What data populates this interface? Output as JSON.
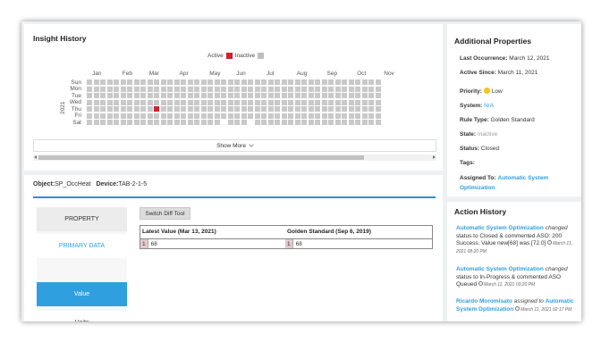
{
  "insight": {
    "title": "Insight History",
    "legend": {
      "active": "Active",
      "inactive": "Inactive"
    },
    "year": "2021",
    "months": [
      "Jan",
      "Feb",
      "Mar",
      "Apr",
      "May",
      "Jun",
      "Jul",
      "Aug",
      "Sep",
      "Oct",
      "Nov"
    ],
    "days": [
      "Sun",
      "Mon",
      "Tue",
      "Wed",
      "Thu",
      "Fri",
      "Sat"
    ],
    "show_more": "Show More"
  },
  "object": {
    "object_label": "Object:",
    "object_value": "SP_OccHeat",
    "device_label": "Device:",
    "device_value": "TAB-2-1-5"
  },
  "property_tabs": {
    "header": "PROPERTY",
    "primary": "PRIMARY DATA",
    "value": "Value",
    "units": "Units"
  },
  "diff": {
    "switch_button": "Switch Diff Tool",
    "left_header": "Latest Value (Mar 13, 2021)",
    "right_header": "Golden Standard (Sep 6, 2019)",
    "left_line_no": "1",
    "left_value": "68",
    "right_line_no": "1",
    "right_value": "68"
  },
  "additional": {
    "title": "Additional Properties",
    "last_occurrence_label": "Last Occurrence:",
    "last_occurrence_value": "March 12, 2021",
    "active_since_label": "Active Since:",
    "active_since_value": "March 11, 2021",
    "priority_label": "Priority:",
    "priority_value": "Low",
    "system_label": "System:",
    "system_value": "N/A",
    "rule_type_label": "Rule Type:",
    "rule_type_value": "Golden Standard",
    "state_label": "State:",
    "state_value": "Inactive",
    "status_label": "Status:",
    "status_value": "Closed",
    "tags_label": "Tags:",
    "assigned_label": "Assigned To:",
    "assigned_value_1": "Automatic System",
    "assigned_value_2": "Optimization"
  },
  "action_history": {
    "title": "Action History",
    "entries": [
      {
        "actor": "Automatic System Optimization",
        "verb": "changed",
        "text": "status to Closed & commented ASO: 200 Success. Value new[68] was [72.0]",
        "time": "March 11, 2021 08:20 PM"
      },
      {
        "actor": "Automatic System Optimization",
        "verb": "changed",
        "text": "status to In-Progress & commented ASO Queued",
        "time": "March 11, 2021 03:20 PM"
      },
      {
        "actor": "Ricardo Moromisato",
        "verb": "assigned to",
        "target": "Automatic System Optimization",
        "time": "March 11, 2021 02:17 PM"
      }
    ]
  },
  "colors": {
    "active": "#d0222b",
    "inactive": "#bdbdbd",
    "accent": "#2f9fe0"
  },
  "heatmap_state": {
    "active_week": 10,
    "active_day": 4,
    "week_count": 44
  }
}
